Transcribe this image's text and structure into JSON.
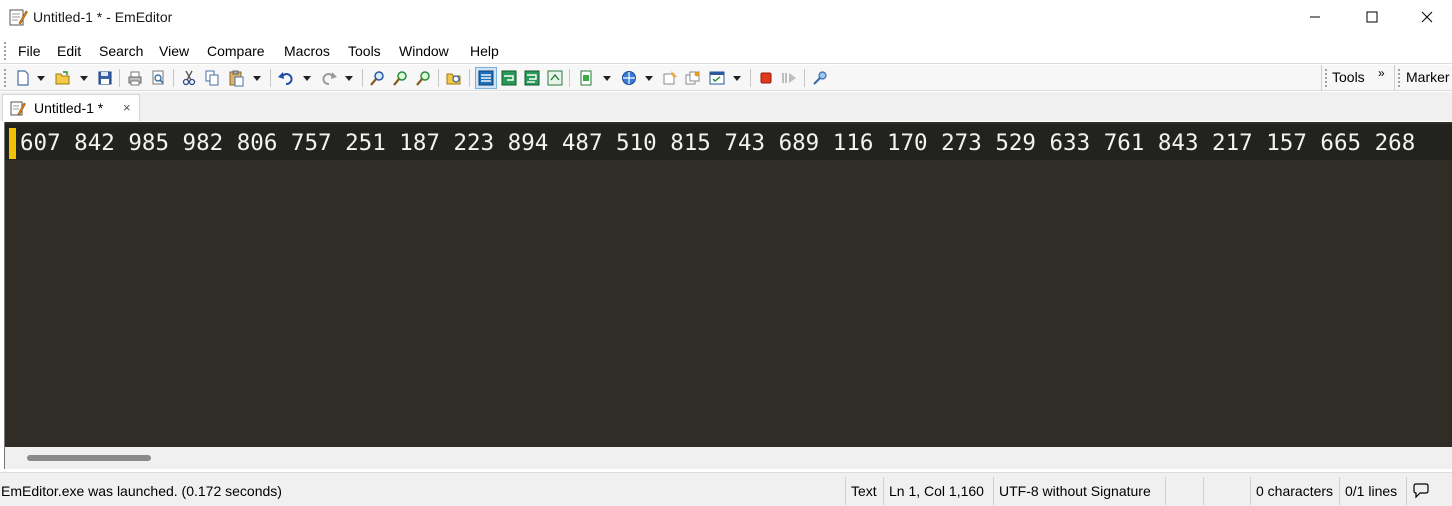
{
  "window": {
    "title": "Untitled-1 * - EmEditor"
  },
  "menu": [
    {
      "label": "File"
    },
    {
      "label": "Edit"
    },
    {
      "label": "Search"
    },
    {
      "label": "View"
    },
    {
      "label": "Compare"
    },
    {
      "label": "Macros"
    },
    {
      "label": "Tools"
    },
    {
      "label": "Window"
    },
    {
      "label": "Help"
    }
  ],
  "toolbar": {
    "tools_label": "Tools",
    "tools_chevron": "»",
    "marker_label": "Marker"
  },
  "tabs": [
    {
      "label": "Untitled-1 *",
      "close": "×"
    }
  ],
  "editor": {
    "line_1": "607 842 985 982 806 757 251 187 223 894 487 510 815 743 689 116 170 273 529 633 761 843 217 157 665 268",
    "background_color": "#302d26",
    "text_color": "#f3f3f3",
    "caret_marker_color": "#f2c200"
  },
  "status": {
    "message": "EmEditor.exe was launched. (0.172 seconds)",
    "mode": "Text",
    "position": "Ln 1, Col 1,160",
    "encoding": "UTF-8 without Signature",
    "chars": "0 characters",
    "lines": "0/1 lines"
  }
}
